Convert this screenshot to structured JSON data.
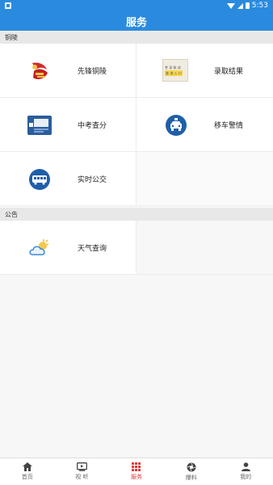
{
  "status": {
    "time": "5:53"
  },
  "header": {
    "title": "服务"
  },
  "sections": [
    {
      "title": "铜陵",
      "items": [
        {
          "label": "先锋铜陵",
          "icon": "pioneer-emblem-icon"
        },
        {
          "label": "录取结果",
          "icon": "admission-results-icon"
        },
        {
          "label": "中考查分",
          "icon": "exam-score-icon"
        },
        {
          "label": "移车警情",
          "icon": "car-move-alert-icon"
        },
        {
          "label": "实时公交",
          "icon": "bus-icon"
        }
      ]
    },
    {
      "title": "公告",
      "items": [
        {
          "label": "天气查询",
          "icon": "weather-icon"
        }
      ]
    }
  ],
  "admission_icon_text": {
    "line1": "考 录 取 成",
    "line2": "查 询 入 口"
  },
  "bottom_nav": [
    {
      "label": "首页",
      "icon": "home-icon"
    },
    {
      "label": "视 听",
      "icon": "video-icon"
    },
    {
      "label": "服务",
      "icon": "services-grid-icon",
      "active": true
    },
    {
      "label": "爆料",
      "icon": "camera-shutter-icon"
    },
    {
      "label": "我的",
      "icon": "user-icon"
    }
  ],
  "colors": {
    "primary": "#2a8bde",
    "active": "#e03a3a",
    "icon_blue": "#1f5fa8"
  }
}
